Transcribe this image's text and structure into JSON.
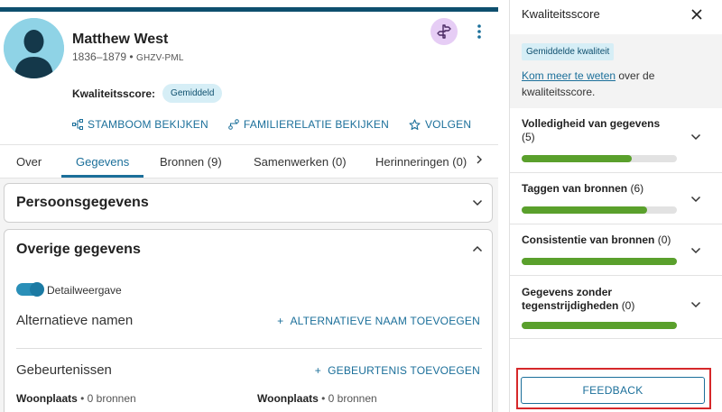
{
  "person": {
    "name": "Matthew West",
    "dates": "1836–1879",
    "id": "GHZV-PML"
  },
  "quality": {
    "label": "Kwaliteitsscore:",
    "badge": "Gemiddeld"
  },
  "actions": [
    {
      "label": "STAMBOOM BEKIJKEN",
      "icon": "tree-icon"
    },
    {
      "label": "FAMILIERELATIE BEKIJKEN",
      "icon": "relationship-icon"
    },
    {
      "label": "VOLGEN",
      "icon": "star-icon"
    }
  ],
  "tabs": [
    {
      "label": "Over"
    },
    {
      "label": "Gegevens",
      "active": true
    },
    {
      "label": "Bronnen (9)"
    },
    {
      "label": "Samenwerken (0)"
    },
    {
      "label": "Herinneringen (0)"
    }
  ],
  "cards": {
    "personal": {
      "title": "Persoonsgegevens"
    },
    "other": {
      "title": "Overige gegevens",
      "toggle_label": "Detailweergave",
      "alt_names": {
        "title": "Alternatieve namen",
        "add": "ALTERNATIEVE NAAM TOEVOEGEN"
      },
      "events": {
        "title": "Gebeurtenissen",
        "add": "GEBEURTENIS TOEVOEGEN"
      },
      "residences": [
        {
          "label": "Woonplaats",
          "sources": "• 0 bronnen"
        },
        {
          "label": "Woonplaats",
          "sources": "• 0 bronnen"
        }
      ]
    }
  },
  "panel": {
    "title": "Kwaliteitsscore",
    "badge": "Gemiddelde kwaliteit",
    "link": "Kom meer te weten",
    "text_after": " over de kwaliteitsscore.",
    "metrics": [
      {
        "label": "Volledigheid van gegevens",
        "count": "(5)",
        "fill": 0.71
      },
      {
        "label": "Taggen van bronnen",
        "count": "(6)",
        "fill": 0.81
      },
      {
        "label": "Consistentie van bronnen",
        "count": "(0)",
        "fill": 1.0
      },
      {
        "label": "Gegevens zonder tegenstrijdigheden",
        "count": "(0)",
        "fill": 1.0
      }
    ],
    "feedback": "FEEDBACK"
  },
  "colors": {
    "accent": "#1b6f9a",
    "progress": "#5aa02c",
    "highlight": "#d6282a"
  }
}
